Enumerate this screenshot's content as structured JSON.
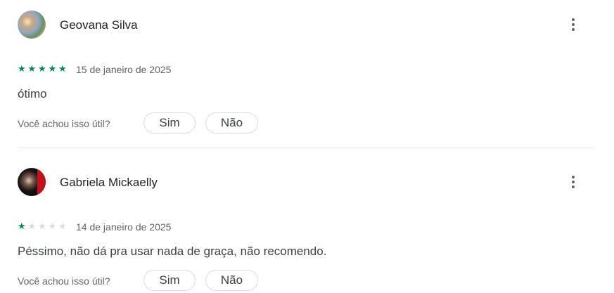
{
  "reviews": [
    {
      "author": "Geovana Silva",
      "rating": 5,
      "rating_max": 5,
      "date": "15 de janeiro de 2025",
      "text": "ótimo",
      "helpful_question": "Você achou isso útil?",
      "yes_label": "Sim",
      "no_label": "Não",
      "more_icon": "more-vert-icon"
    },
    {
      "author": "Gabriela Mickaelly",
      "rating": 1,
      "rating_max": 5,
      "date": "14 de janeiro de 2025",
      "text": "Péssimo, não dá pra usar nada de graça, não recomendo.",
      "helpful_question": "Você achou isso útil?",
      "yes_label": "Sim",
      "no_label": "Não",
      "more_icon": "more-vert-icon"
    }
  ],
  "colors": {
    "star_filled": "#01875f",
    "star_empty": "#dadce0",
    "divider": "#e6e6e6"
  }
}
